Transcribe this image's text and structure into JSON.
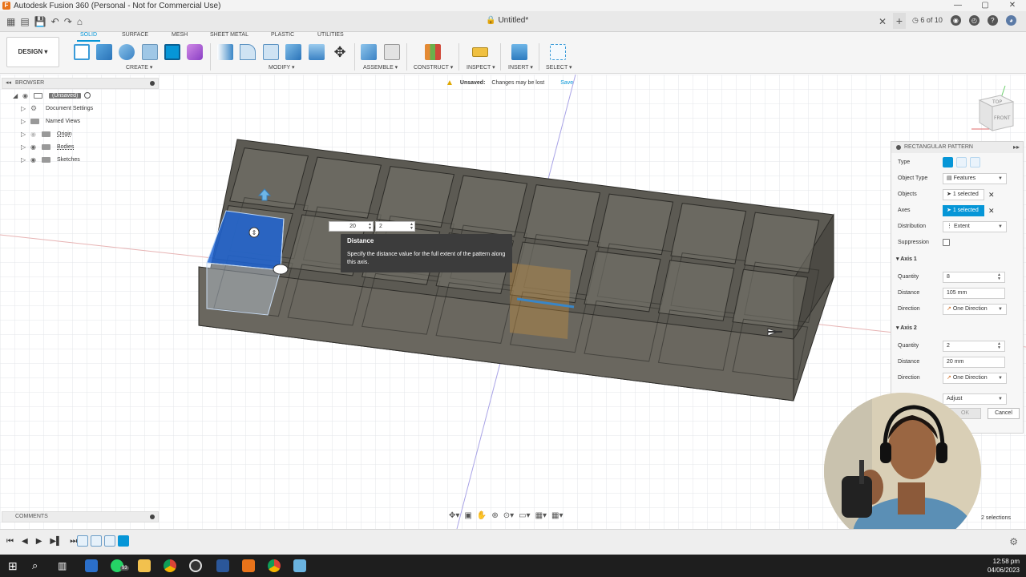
{
  "window": {
    "title": "Autodesk Fusion 360 (Personal - Not for Commercial Use)",
    "controls": [
      "—",
      "▢",
      "✕"
    ]
  },
  "document_tab": {
    "title": "Untitled*",
    "jobs": "6 of 10"
  },
  "toolbar": {
    "workspace": "DESIGN ▾",
    "tabs": [
      "SOLID",
      "SURFACE",
      "MESH",
      "SHEET METAL",
      "PLASTIC",
      "UTILITIES"
    ],
    "active_tab": "SOLID",
    "groups": {
      "create": "CREATE ▾",
      "modify": "MODIFY ▾",
      "assemble": "ASSEMBLE ▾",
      "construct": "CONSTRUCT ▾",
      "inspect": "INSPECT ▾",
      "insert": "INSERT ▾",
      "select": "SELECT ▾"
    }
  },
  "unsaved_banner": {
    "label": "Unsaved:",
    "message": "Changes may be lost",
    "action": "Save"
  },
  "browser": {
    "header": "BROWSER",
    "items": [
      {
        "label": "(Unsaved)"
      },
      {
        "label": "Document Settings"
      },
      {
        "label": "Named Views"
      },
      {
        "label": "Origin"
      },
      {
        "label": "Bodies"
      },
      {
        "label": "Sketches"
      }
    ]
  },
  "canvas_input": {
    "distance_value": "20",
    "quantity_value": "2"
  },
  "tooltip": {
    "title": "Distance",
    "body": "Specify the distance value for the full extent of the pattern along this axis."
  },
  "viewcube": {
    "top": "TOP",
    "front": "FRONT"
  },
  "pattern_panel": {
    "title": "RECTANGULAR PATTERN",
    "type_label": "Type",
    "object_type_label": "Object Type",
    "object_type_value": "Features",
    "objects_label": "Objects",
    "objects_value": "1 selected",
    "axes_label": "Axes",
    "axes_value": "1 selected",
    "distribution_label": "Distribution",
    "distribution_value": "Extent",
    "suppression_label": "Suppression",
    "axis1": {
      "title": "Axis 1",
      "quantity_label": "Quantity",
      "quantity": "8",
      "distance_label": "Distance",
      "distance": "105 mm",
      "direction_label": "Direction",
      "direction": "One Direction"
    },
    "axis2": {
      "title": "Axis 2",
      "quantity_label": "Quantity",
      "quantity": "2",
      "distance_label": "Distance",
      "distance": "20 mm",
      "direction_label": "Direction",
      "direction": "One Direction"
    },
    "compute_value": "Adjust",
    "ok": "OK",
    "cancel": "Cancel"
  },
  "comments": {
    "label": "COMMENTS"
  },
  "status": {
    "selections": "2 selections"
  },
  "taskbar": {
    "time": "12:58 pm",
    "date": "04/06/2023",
    "badge": "93"
  },
  "colors": {
    "accent": "#0696d7",
    "body": "#4f4d47",
    "selected_face": "#1e64d2"
  }
}
